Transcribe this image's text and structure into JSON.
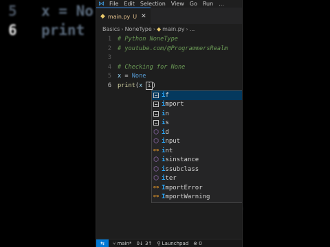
{
  "background": {
    "left_lines": [
      {
        "number": "5",
        "code": "x = No"
      },
      {
        "number": "6",
        "code": "print"
      }
    ],
    "right_text": [
      "e",
      "s"
    ]
  },
  "menubar": {
    "items": [
      "File",
      "Edit",
      "Selection",
      "View",
      "Go",
      "Run"
    ],
    "more": "..."
  },
  "tab": {
    "filename": "main.py",
    "status": "U",
    "close": "✕"
  },
  "breadcrumb": [
    "Basics",
    "NoneType",
    "main.py",
    "..."
  ],
  "code_lines": [
    {
      "number": "1",
      "segments": [
        {
          "t": "# Python NoneType",
          "c": "comment"
        }
      ]
    },
    {
      "number": "2",
      "segments": [
        {
          "t": "# youtube.com/@ProgrammersRealm",
          "c": "comment"
        }
      ]
    },
    {
      "number": "3",
      "segments": []
    },
    {
      "number": "4",
      "segments": [
        {
          "t": "# Checking for None",
          "c": "comment"
        }
      ]
    },
    {
      "number": "5",
      "segments": [
        {
          "t": "x",
          "c": "var"
        },
        {
          "t": " = ",
          "c": "op"
        },
        {
          "t": "None",
          "c": "const"
        }
      ]
    },
    {
      "number": "6",
      "active": true,
      "segments": [
        {
          "t": "print",
          "c": "fn"
        },
        {
          "t": "(",
          "c": "text"
        },
        {
          "t": "x",
          "c": "var"
        },
        {
          "t": " ",
          "c": "text"
        },
        {
          "t": "i",
          "c": "box"
        },
        {
          "t": ")",
          "c": "text"
        }
      ]
    }
  ],
  "suggestions": [
    {
      "match": "i",
      "rest": "f",
      "kind": "keyword",
      "selected": true
    },
    {
      "match": "i",
      "rest": "mport",
      "kind": "keyword"
    },
    {
      "match": "i",
      "rest": "n",
      "kind": "keyword"
    },
    {
      "match": "i",
      "rest": "s",
      "kind": "keyword"
    },
    {
      "match": "i",
      "rest": "d",
      "kind": "function"
    },
    {
      "match": "i",
      "rest": "nput",
      "kind": "function"
    },
    {
      "match": "i",
      "rest": "nt",
      "kind": "class"
    },
    {
      "match": "i",
      "rest": "sinstance",
      "kind": "function"
    },
    {
      "match": "i",
      "rest": "ssubclass",
      "kind": "function"
    },
    {
      "match": "i",
      "rest": "ter",
      "kind": "function"
    },
    {
      "match": "I",
      "rest": "mportError",
      "kind": "class"
    },
    {
      "match": "I",
      "rest": "mportWarning",
      "kind": "class"
    }
  ],
  "statusbar": {
    "branch": "main*",
    "sync": "0↓ 3↑",
    "launchpad": "Launchpad",
    "problems": "⊗ 0"
  },
  "colors": {
    "accent": "#0078d4",
    "tab_border": "#3794ff",
    "match": "#2aaaff"
  }
}
